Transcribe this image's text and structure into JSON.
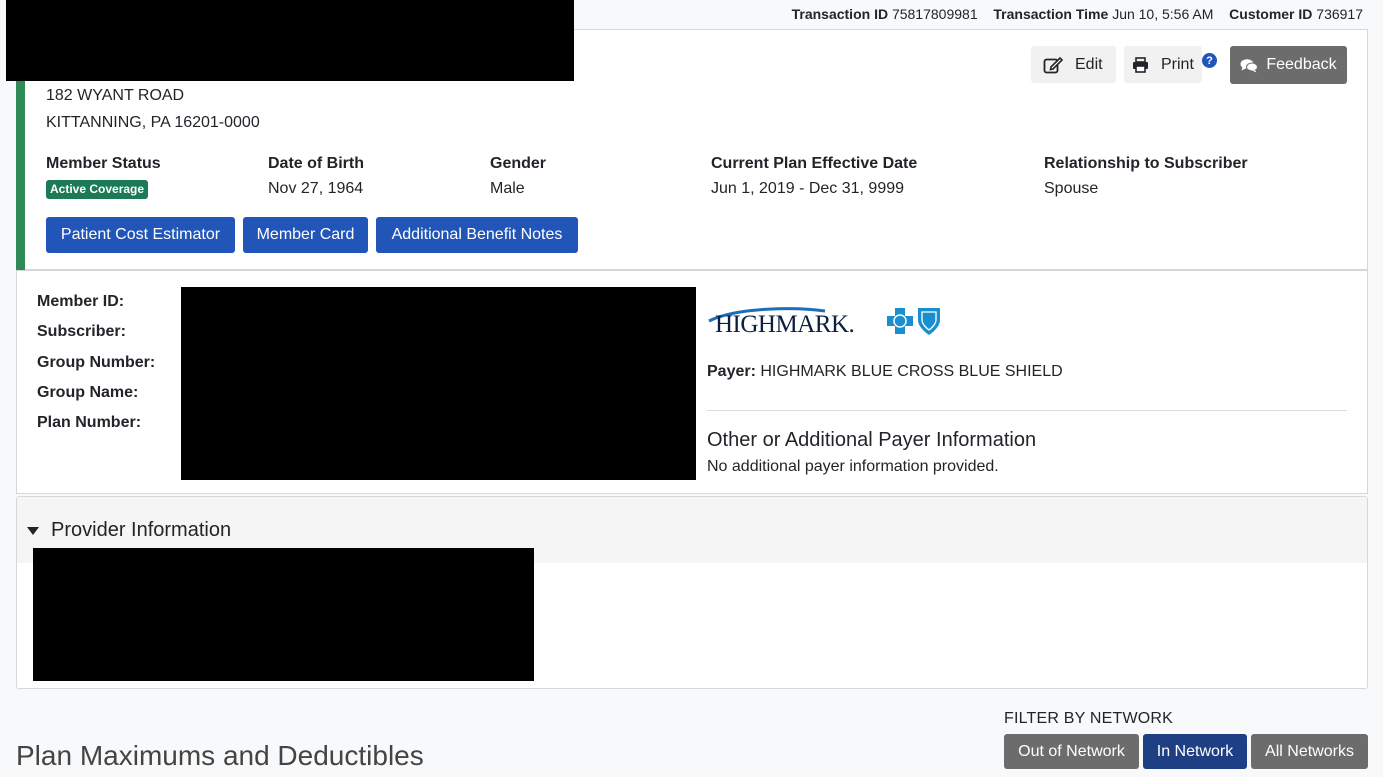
{
  "transaction": {
    "id_label": "Transaction ID",
    "id_value": "75817809981",
    "time_label": "Transaction Time",
    "time_value": "Jun 10, 5:56 AM",
    "customer_label": "Customer ID",
    "customer_value": "736917"
  },
  "toolbar": {
    "edit_label": "Edit",
    "print_label": "Print",
    "help_label": "?",
    "feedback_label": "Feedback"
  },
  "member": {
    "address_line1": "182 WYANT ROAD",
    "address_line2": "KITTANNING, PA 16201-0000",
    "status_label": "Member Status",
    "status_badge": "Active Coverage",
    "dob_label": "Date of Birth",
    "dob_value": "Nov 27, 1964",
    "gender_label": "Gender",
    "gender_value": "Male",
    "plan_date_label": "Current Plan Effective Date",
    "plan_date_value": "Jun 1, 2019 - Dec 31, 9999",
    "relationship_label": "Relationship to Subscriber",
    "relationship_value": "Spouse"
  },
  "actions": {
    "cost_estimator": "Patient Cost Estimator",
    "member_card": "Member Card",
    "benefit_notes": "Additional Benefit Notes"
  },
  "ids": {
    "member_id_label": "Member ID:",
    "subscriber_label": "Subscriber:",
    "group_number_label": "Group Number:",
    "group_name_label": "Group Name:",
    "plan_number_label": "Plan Number:"
  },
  "payer": {
    "logo_text": "HIGHMARK.",
    "payer_label": "Payer:",
    "payer_value": "HIGHMARK BLUE CROSS BLUE SHIELD",
    "other_heading": "Other or Additional Payer Information",
    "other_text": "No additional payer information provided."
  },
  "provider": {
    "title": "Provider Information"
  },
  "filter": {
    "label": "FILTER BY NETWORK",
    "out_network": "Out of Network",
    "in_network": "In Network",
    "all_networks": "All Networks"
  },
  "plan": {
    "title": "Plan Maximums and Deductibles"
  },
  "colors": {
    "accent_green": "#2e8b57",
    "button_blue": "#2255b8",
    "active_filter": "#1f3f85",
    "inactive_filter": "#6c6c6c"
  }
}
